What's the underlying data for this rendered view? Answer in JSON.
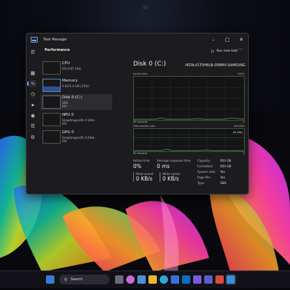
{
  "window": {
    "title": "Task Manager"
  },
  "toolbar": {
    "page_title": "Performance",
    "run_task_label": "Run new task",
    "more_label": "···"
  },
  "devices": [
    {
      "name": "CPU",
      "line1": "0%  0.87 GHz"
    },
    {
      "name": "Memory",
      "line1": "4.8/15.4 GB (32%)"
    },
    {
      "name": "Disk 0 (C:)",
      "line1": "SSD",
      "line2": "0%"
    },
    {
      "name": "NPU 0",
      "line1": "Snapdragon(R) X Elite -",
      "line2": "0%"
    },
    {
      "name": "GPU 0",
      "line1": "Snapdragon(R) X Elite -",
      "line2": "0%"
    }
  ],
  "detail": {
    "title": "Disk 0 (C:)",
    "model": "MZ9L41T0HBLB-00BMV-SAMSUNG",
    "graph1": {
      "label_left": "Active time",
      "label_right": "100%",
      "footer_left": "60 seconds",
      "footer_right": "0"
    },
    "graph2": {
      "label_left": "Disk transfer rate",
      "label_right": "100 KB/s",
      "inner_right": "60 KB/s",
      "footer_left": "60 seconds",
      "footer_right": "0"
    },
    "active_time": {
      "label": "Active time",
      "value": "0%"
    },
    "response": {
      "label": "Average response time",
      "value": "0 ms"
    },
    "read": {
      "label": "Read speed",
      "value": "0 KB/s"
    },
    "write": {
      "label": "Write speed",
      "value": "0 KB/s"
    },
    "props": [
      {
        "k": "Capacity:",
        "v": "954 GB"
      },
      {
        "k": "Formatted:",
        "v": "954 GB"
      },
      {
        "k": "System disk:",
        "v": "Yes"
      },
      {
        "k": "Page file:",
        "v": "Yes"
      },
      {
        "k": "Type:",
        "v": "SSD"
      }
    ]
  },
  "taskbar": {
    "search_label": "Search"
  },
  "colors": {
    "accent": "#6fb2ff",
    "graph_border": "#3b5a3b",
    "graph_line": "#4caf50"
  }
}
